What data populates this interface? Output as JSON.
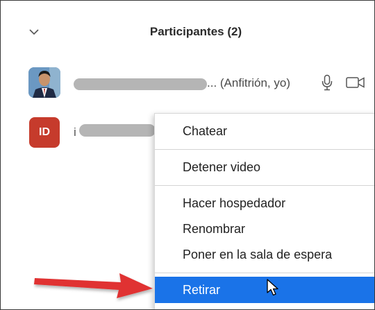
{
  "panel": {
    "title": "Participantes (2)",
    "collapse_icon": "chevron-down-icon"
  },
  "participants": [
    {
      "host_suffix": "... (Anfitrión, yo)",
      "avatar": "photo",
      "mic_icon": "microphone-icon",
      "video_icon": "video-camera-icon"
    },
    {
      "initials": "ID",
      "name_visible": "i",
      "avatar_color": "#c63b2c"
    }
  ],
  "context_menu": {
    "items": [
      "Chatear",
      "Detener video",
      "Hacer hospedador",
      "Renombrar",
      "Poner en la sala de espera",
      "Retirar"
    ],
    "highlighted": "Retirar",
    "highlight_color": "#1a73e8"
  },
  "annotation": {
    "arrow_color": "#e03030"
  }
}
